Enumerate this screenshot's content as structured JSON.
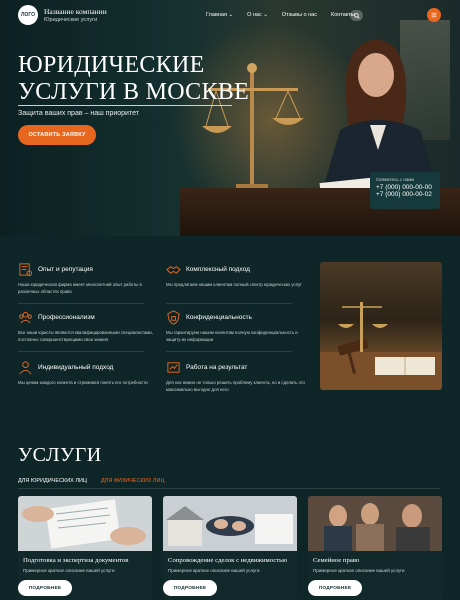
{
  "header": {
    "logo_text": "ЛОГО",
    "company_name": "Название компании",
    "company_sub": "Юридические услуги",
    "menu": [
      "Главная ⌄",
      "О нас ⌄",
      "Отзывы о нас",
      "Контакты"
    ],
    "search_icon": "search-icon",
    "action_icon": "menu-icon",
    "accent_color": "#e8671e"
  },
  "hero": {
    "title_line1": "ЮРИДИЧЕСКИЕ",
    "title_line2": "УСЛУГИ В МОСКВЕ",
    "subtitle": "Защита ваших прав – наш приоритет",
    "cta": "ОСТАВИТЬ ЗАЯВКУ"
  },
  "contact": {
    "label": "Свяжитесь с нами",
    "phone1": "+7 (000) 000-00-00",
    "phone2": "+7 (000) 000-00-02"
  },
  "features": [
    {
      "title": "Опыт и репутация",
      "desc": "Наша юридическая фирма имеет многолетний опыт работы в различных областях права",
      "icon": "certificate-icon"
    },
    {
      "title": "Комплексный подход",
      "desc": "Мы предлагаем нашим клиентам полный спектр юридических услуг",
      "icon": "handshake-icon"
    },
    {
      "title": "Профессионализм",
      "desc": "Все наши юристы являются квалифицированными специалистами, постоянно совершенствующими свои знания",
      "icon": "team-icon"
    },
    {
      "title": "Конфиденциальность",
      "desc": "Мы гарантируем нашим клиентам полную конфиденциальность и защиту их информации",
      "icon": "shield-icon"
    },
    {
      "title": "Индивидуальный подход",
      "desc": "Мы ценим каждого клиента и стремимся понять его потребности",
      "icon": "person-icon"
    },
    {
      "title": "Работа на результат",
      "desc": "Для нас важно не только решить проблему клиента, но и сделать это максимально выгодно для него",
      "icon": "target-icon"
    }
  ],
  "services": {
    "title": "УСЛУГИ",
    "tab_active": "ДЛЯ ЮРИДИЧЕСКИХ ЛИЦ",
    "tab_inactive": "ДЛЯ ФИЗИЧЕСКИХ ЛИЦ",
    "cards": [
      {
        "title": "Подготовка и экспертиза документов",
        "desc": "Примерное краткое описание вашей услуги",
        "button": "ПОДРОБНЕЕ"
      },
      {
        "title": "Сопровождение сделок с недвижимостью",
        "desc": "Примерное краткое описание вашей услуги",
        "button": "ПОДРОБНЕЕ"
      },
      {
        "title": "Семейное право",
        "desc": "Примерное краткое описание вашей услуги",
        "button": "ПОДРОБНЕЕ"
      }
    ]
  }
}
